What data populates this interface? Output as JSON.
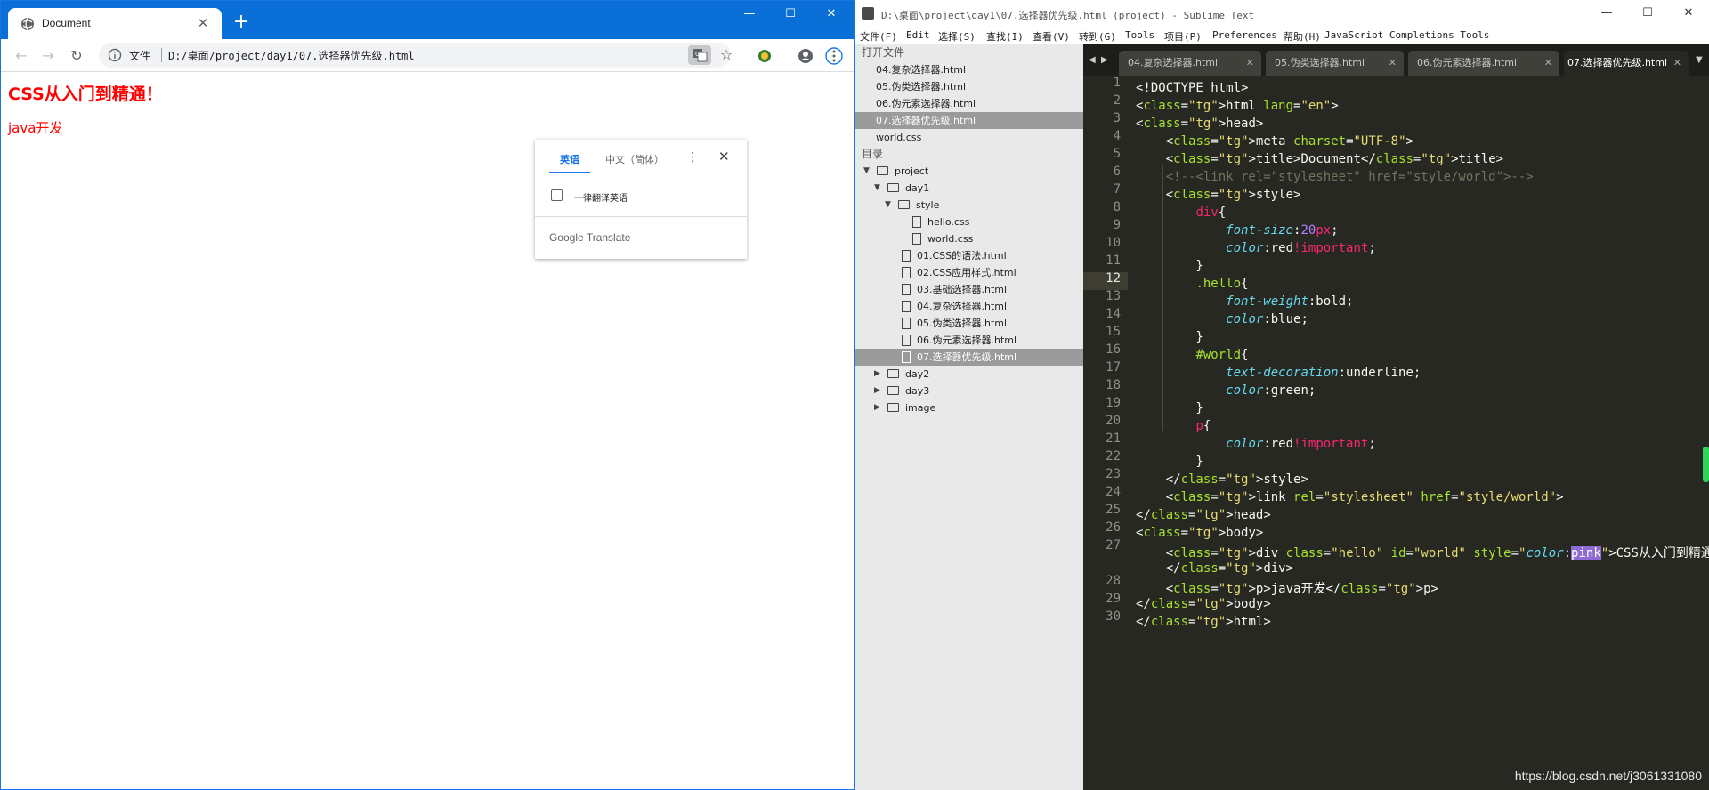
{
  "chrome": {
    "tab_title": "Document",
    "tab_close": "✕",
    "new_tab": "+",
    "window_buttons": [
      "—",
      "☐",
      "✕"
    ],
    "nav": {
      "back": "←",
      "forward": "→",
      "reload": "↻"
    },
    "omnibox": {
      "scheme": "文件",
      "url": "D:/桌面/project/day1/07.选择器优先级.html"
    },
    "star": "☆",
    "page": {
      "heading": "CSS从入门到精通！",
      "paragraph": "java开发"
    },
    "translate_popup": {
      "tab_source": "英语",
      "tab_target": "中文（简体）",
      "menu": "⋮",
      "close": "✕",
      "checkbox_label": "一律翻译英语",
      "brand": "Google Translate"
    }
  },
  "sublime": {
    "title": "D:\\桌面\\project\\day1\\07.选择器优先级.html (project) - Sublime Text",
    "window_buttons": [
      "—",
      "☐",
      "✕"
    ],
    "menu": [
      "文件(F)",
      "Edit",
      "选择(S)",
      "查找(I)",
      "查看(V)",
      "转到(G)",
      "Tools",
      "项目(P)",
      "Preferences",
      "帮助(H)",
      "JavaScript Completions Tools"
    ],
    "sidebar": {
      "open_files_header": "打开文件",
      "open_files": [
        "04.复杂选择器.html",
        "05.伪类选择器.html",
        "06.伪元素选择器.html",
        "07.选择器优先级.html",
        "world.css"
      ],
      "folders_header": "目录",
      "tree": {
        "project": "project",
        "day1": "day1",
        "style": "style",
        "style_files": [
          "hello.css",
          "world.css"
        ],
        "day1_files": [
          "01.CSS的语法.html",
          "02.CSS应用样式.html",
          "03.基础选择器.html",
          "04.复杂选择器.html",
          "05.伪类选择器.html",
          "06.伪元素选择器.html",
          "07.选择器优先级.html"
        ],
        "other_folders": [
          "day2",
          "day3",
          "image"
        ]
      }
    },
    "tabs": [
      "04.复杂选择器.html",
      "05.伪类选择器.html",
      "06.伪元素选择器.html",
      "07.选择器优先级.html"
    ],
    "tab_close": "✕",
    "line_numbers": [
      "1",
      "2",
      "3",
      "4",
      "5",
      "6",
      "7",
      "8",
      "9",
      "10",
      "11",
      "12",
      "13",
      "14",
      "15",
      "16",
      "17",
      "18",
      "19",
      "20",
      "21",
      "22",
      "23",
      "24",
      "25",
      "26",
      "27",
      "",
      "28",
      "29",
      "30"
    ],
    "code_lines": [
      "<!DOCTYPE html>",
      "<html lang=\"en\">",
      "<head>",
      "    <meta charset=\"UTF-8\">",
      "    <title>Document</title>",
      "    <!--<link rel=\"stylesheet\" href=\"style/world\">-->",
      "    <style>",
      "        div{",
      "            font-size:20px;",
      "            color:red!important;",
      "        }",
      "        .hello{",
      "            font-weight:bold;",
      "            color:blue;",
      "        }",
      "        #world{",
      "            text-decoration:underline;",
      "            color:green;",
      "        }",
      "        p{",
      "            color:red!important;",
      "        }",
      "    </style>",
      "    <link rel=\"stylesheet\" href=\"style/world\">",
      "</head>",
      "<body>",
      "    <div class=\"hello\" id=\"world\" style=\"color:pink\">CSS从入门到精通！",
      "    </div>",
      "    <p>java开发</p>",
      "</body>",
      "</html>"
    ],
    "current_line": "12",
    "watermark": "https://blog.csdn.net/j3061331080"
  }
}
